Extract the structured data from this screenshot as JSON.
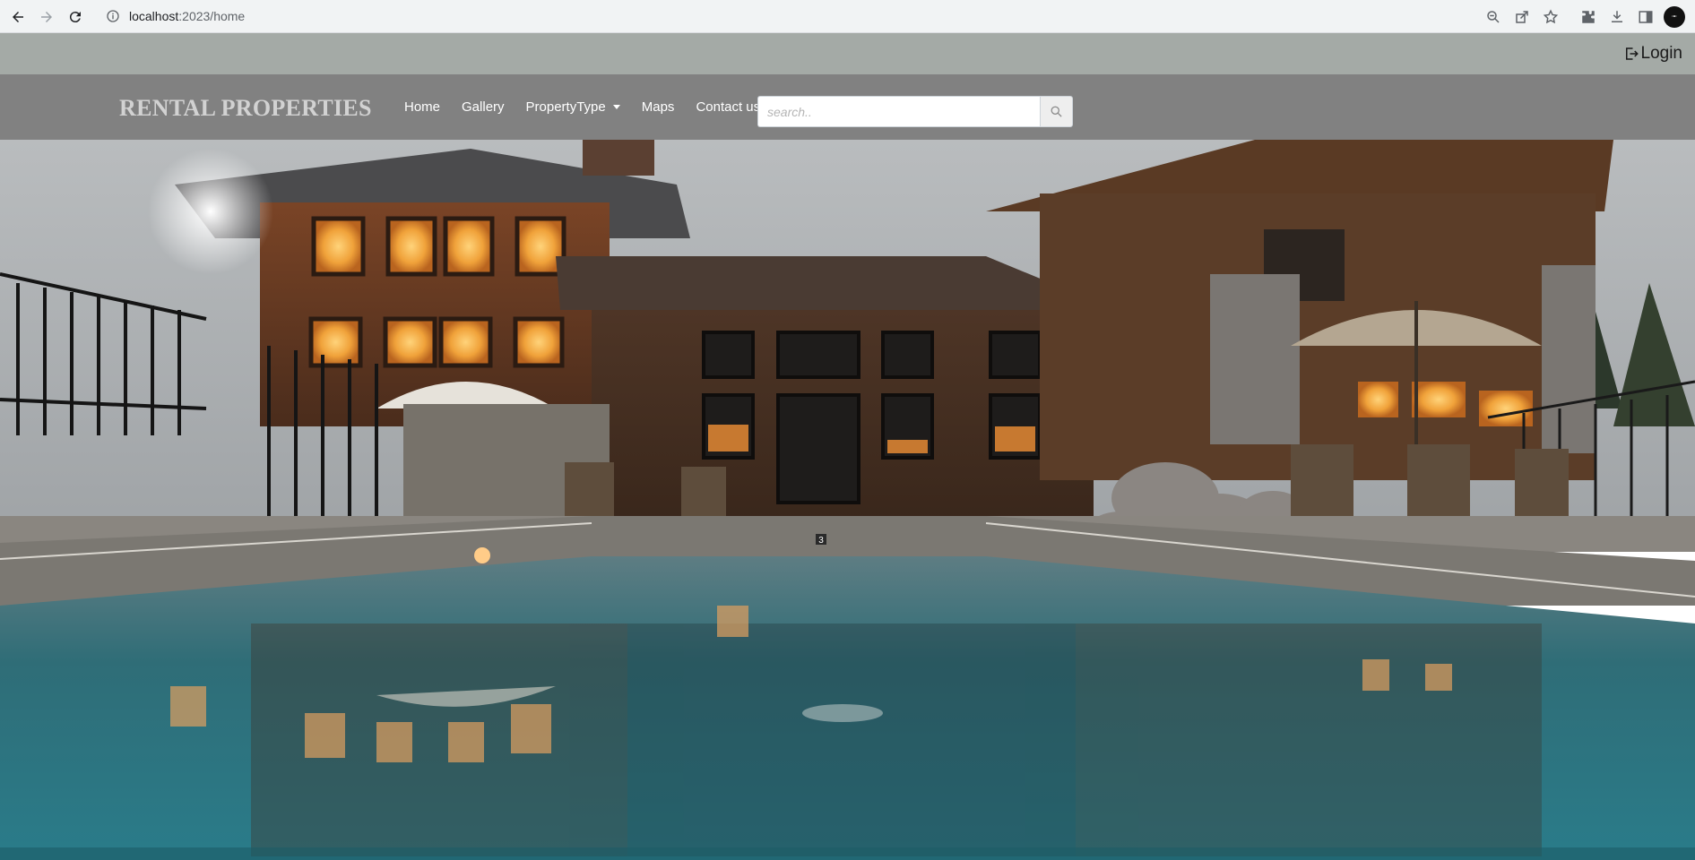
{
  "browser": {
    "url_host": "localhost",
    "url_rest": ":2023/home"
  },
  "site": {
    "login_label": "Login",
    "brand": "RENTAL PROPERTIES",
    "menu": [
      {
        "label": "Home"
      },
      {
        "label": "Gallery"
      },
      {
        "label": "PropertyType"
      },
      {
        "label": "Maps"
      },
      {
        "label": "Contact us"
      }
    ],
    "search": {
      "placeholder": "search.."
    },
    "colors": {
      "topstrip": "#a4aaa6",
      "navbar": "#818181",
      "brand": "#d2d2d2"
    }
  },
  "hero": {
    "pool_marker": "3"
  }
}
